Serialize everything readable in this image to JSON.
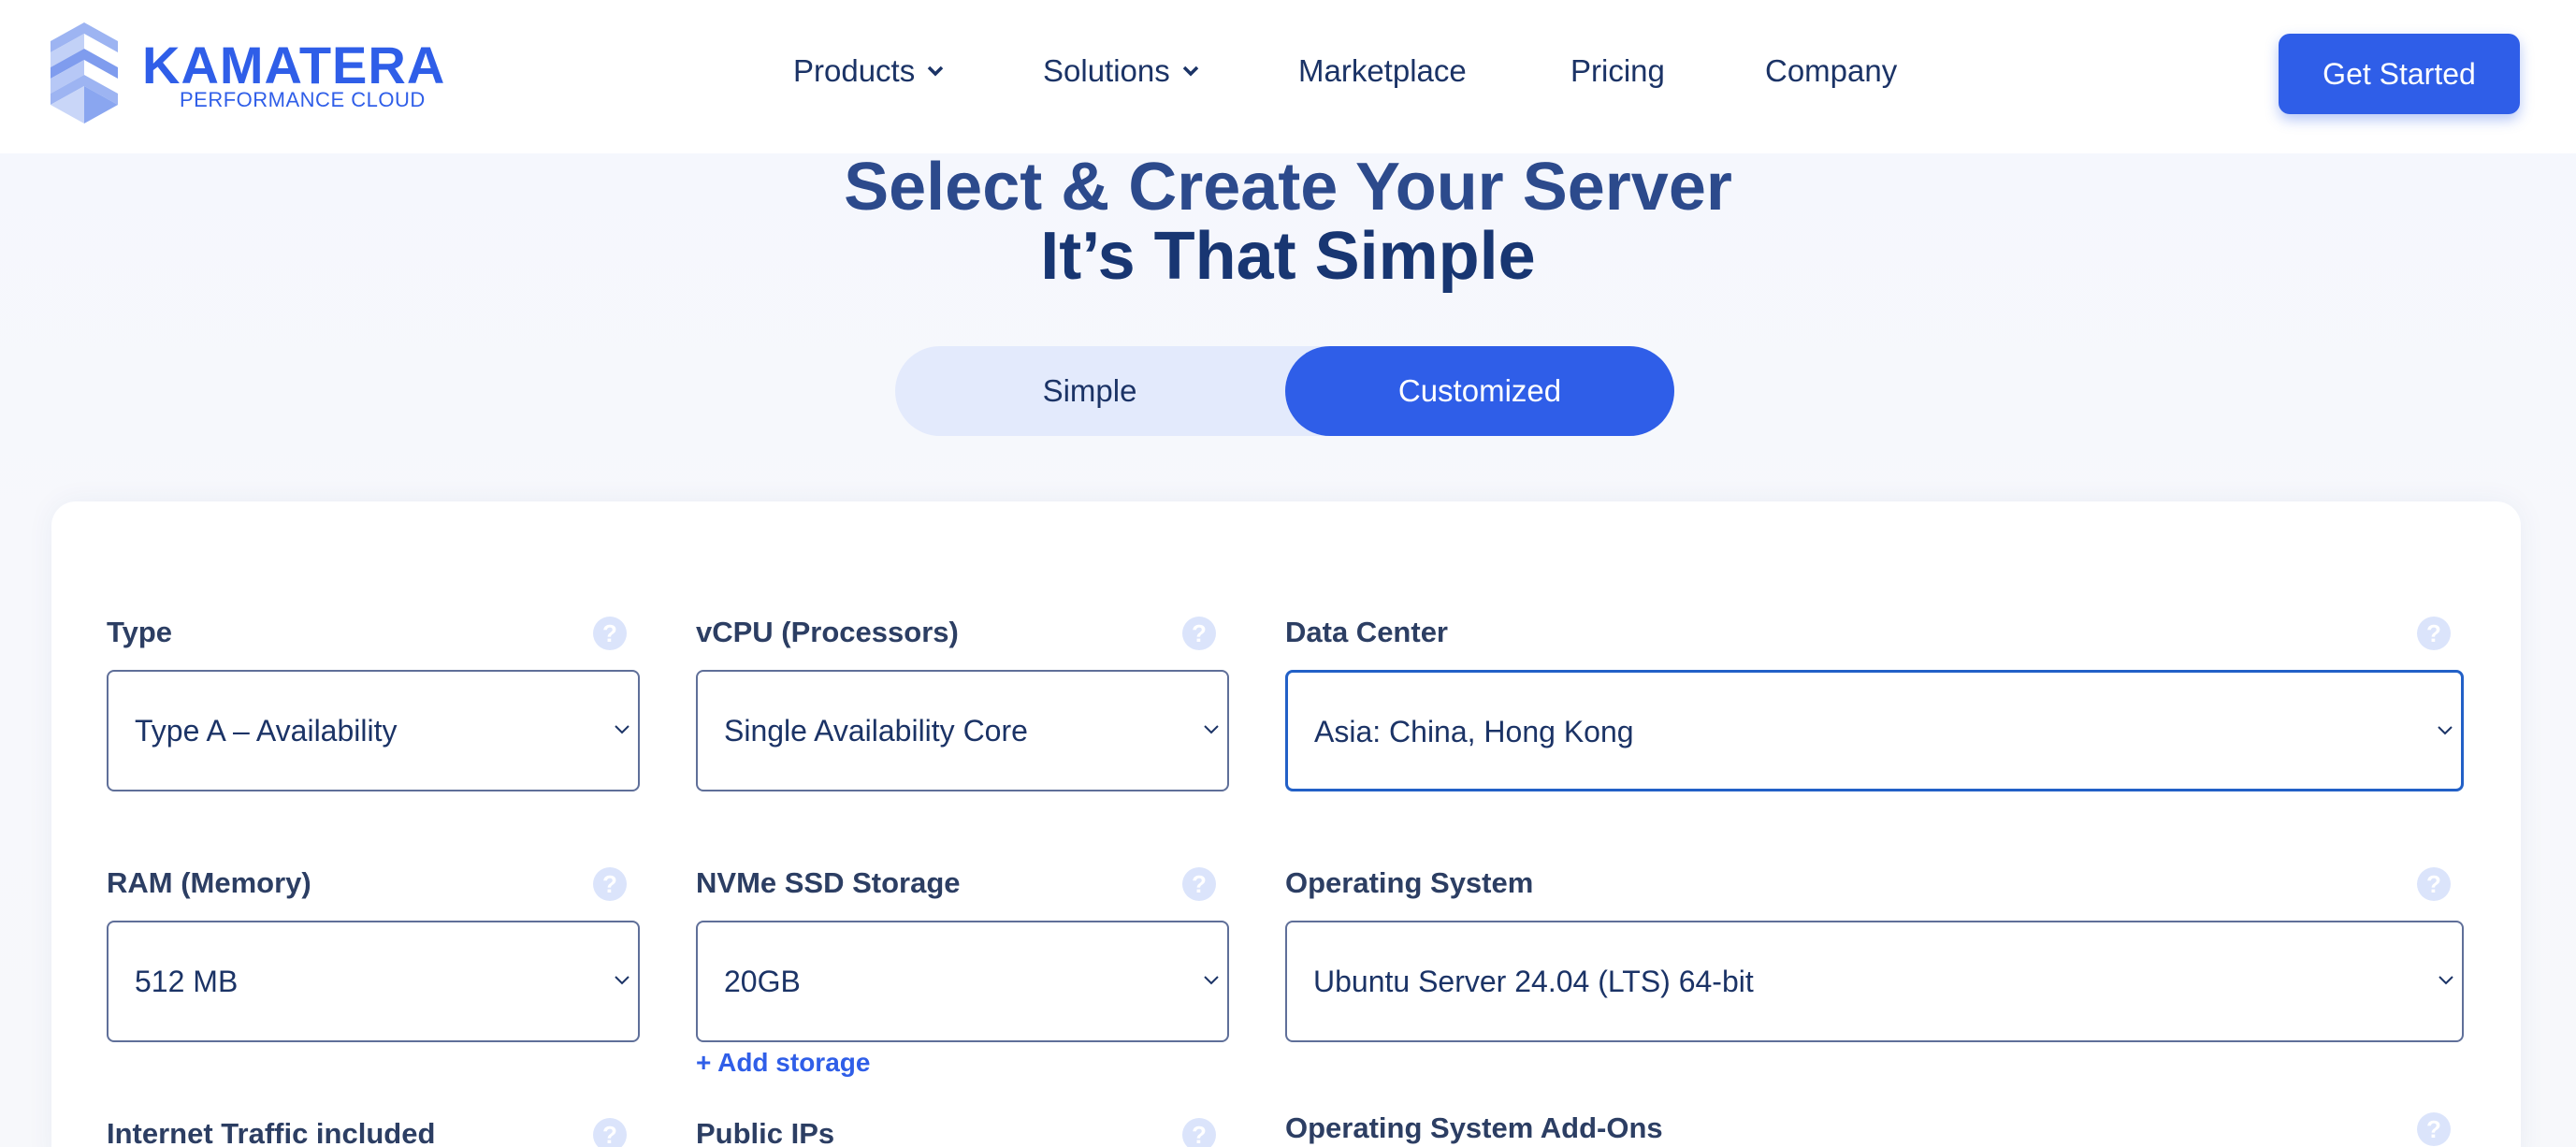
{
  "brand": {
    "name": "KAMATERA",
    "tagline": "PERFORMANCE CLOUD",
    "color": "#2f5ee8"
  },
  "nav": {
    "items": [
      {
        "label": "Products",
        "has_dropdown": true
      },
      {
        "label": "Solutions",
        "has_dropdown": true
      },
      {
        "label": "Marketplace",
        "has_dropdown": false
      },
      {
        "label": "Pricing",
        "has_dropdown": false
      },
      {
        "label": "Company",
        "has_dropdown": false
      }
    ],
    "cta_label": "Get Started"
  },
  "hero": {
    "title_line1": "Select & Create Your Server",
    "title_line2": "It’s That Simple"
  },
  "mode_toggle": {
    "options": [
      "Simple",
      "Customized"
    ],
    "selected": "Customized"
  },
  "configurator": {
    "help_icon_glyph": "?",
    "fields": {
      "type": {
        "label": "Type",
        "value": "Type A – Availability"
      },
      "vcpu": {
        "label": "vCPU (Processors)",
        "value": "Single Availability Core"
      },
      "data_center": {
        "label": "Data Center",
        "value": "Asia: China, Hong Kong",
        "focused": true
      },
      "ram": {
        "label": "RAM (Memory)",
        "value": "512 MB"
      },
      "storage": {
        "label": "NVMe SSD Storage",
        "value": "20GB",
        "add_link": "+ Add storage"
      },
      "os": {
        "label": "Operating System",
        "value": "Ubuntu Server 24.04 (LTS) 64-bit"
      },
      "traffic": {
        "label": "Internet Traffic included"
      },
      "public_ips": {
        "label": "Public IPs"
      },
      "os_addons": {
        "label": "Operating System Add-Ons"
      }
    }
  },
  "colors": {
    "accent": "#2f5ee8",
    "heading": "#2c4a8c",
    "text": "#1b3366",
    "focus_border": "#2260c7"
  }
}
